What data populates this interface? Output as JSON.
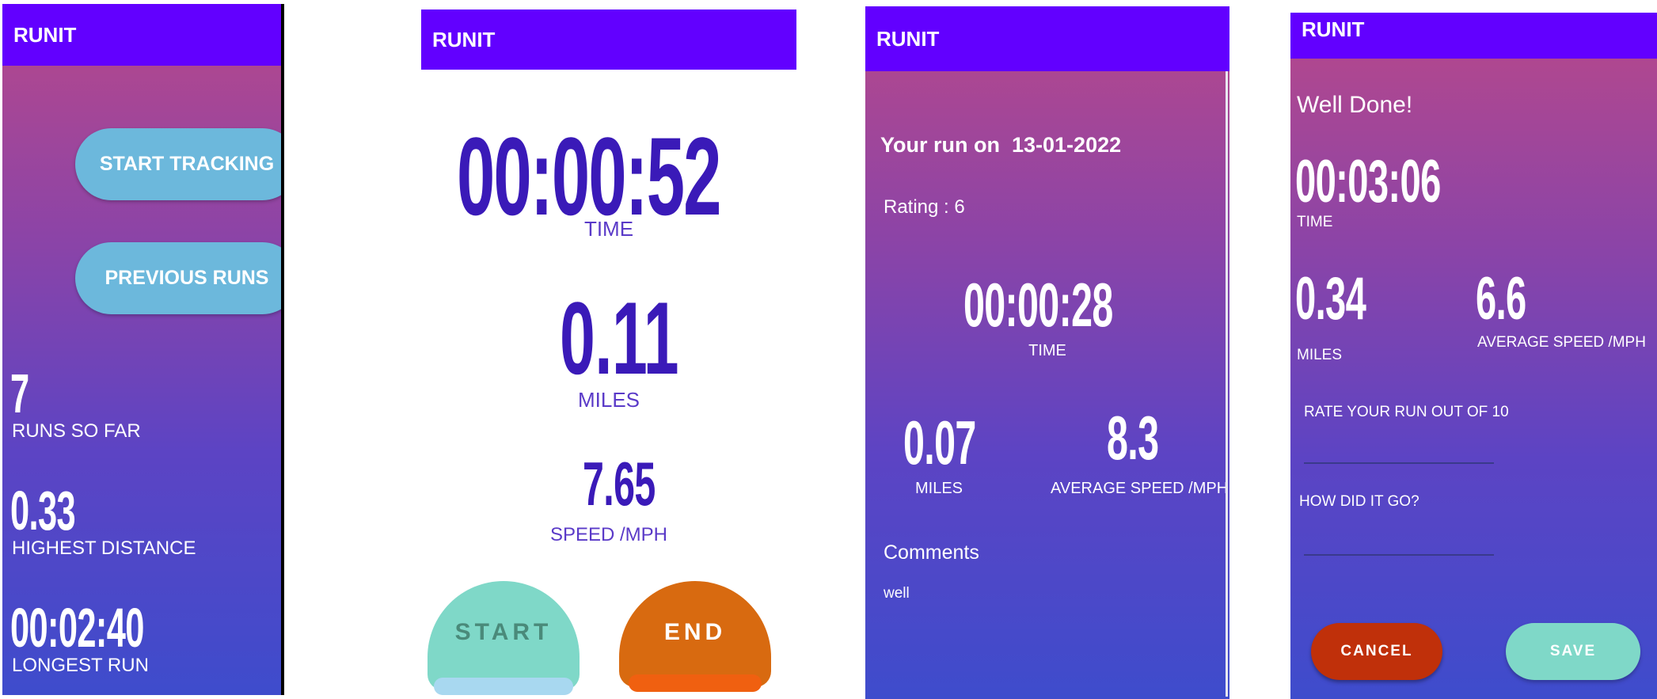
{
  "app_title": "RUNIT",
  "home": {
    "start_tracking": "START TRACKING",
    "previous_runs": "PREVIOUS RUNS",
    "runs_so_far_value": "7",
    "runs_so_far_label": "RUNS SO FAR",
    "highest_distance_value": "0.33",
    "highest_distance_label": "HIGHEST DISTANCE",
    "longest_run_value": "00:02:40",
    "longest_run_label": "LONGEST RUN"
  },
  "tracking": {
    "time_value": "00:00:52",
    "time_label": "TIME",
    "miles_value": "0.11",
    "miles_label": "MILES",
    "speed_value": "7.65",
    "speed_label": "SPEED /MPH",
    "start_button": "START",
    "end_button": "END",
    "colors": {
      "text": "#3a1ab8",
      "start": "#7fd8c8",
      "end": "#d86a10"
    }
  },
  "run_detail": {
    "heading_prefix": "Your run on",
    "date": "13-01-2022",
    "rating": "Rating : 6",
    "time_value": "00:00:28",
    "time_label": "TIME",
    "miles_value": "0.07",
    "miles_label": "MILES",
    "speed_value": "8.3",
    "speed_label": "AVERAGE SPEED /MPH",
    "comments_label": "Comments",
    "comments_text": "well"
  },
  "finish": {
    "heading": "Well Done!",
    "time_value": "00:03:06",
    "time_label": "TIME",
    "miles_value": "0.34",
    "miles_label": "MILES",
    "speed_value": "6.6",
    "speed_label": "AVERAGE SPEED /MPH",
    "rate_label": "RATE YOUR RUN OUT OF 10",
    "rate_value": "",
    "how_label": "HOW DID IT GO?",
    "how_value": "",
    "cancel_button": "CANCEL",
    "save_button": "SAVE"
  }
}
